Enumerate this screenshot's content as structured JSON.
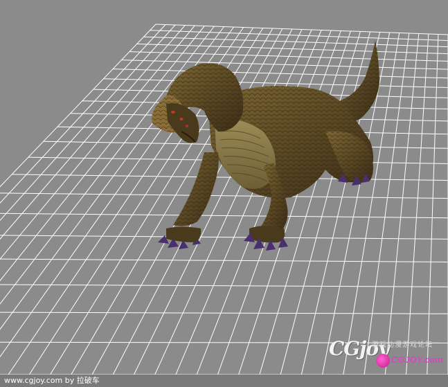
{
  "viewport": {
    "background_color": "#8b8b8b",
    "grid_color": "#ffffff",
    "creature_palette": {
      "skin_dark": "#3d2f18",
      "skin_mid": "#6a5427",
      "skin_light": "#8e7a45",
      "belly": "#9a8a55",
      "claw": "#4a2f6e",
      "eye": "#c0392b"
    }
  },
  "watermark": {
    "logo_text": "CGjoy",
    "cn_text": "游戏动漫游戏论坛",
    "site_text": "CGJOY.com"
  },
  "status_bar": {
    "text": "www.cgjoy.com by 拉破车"
  }
}
